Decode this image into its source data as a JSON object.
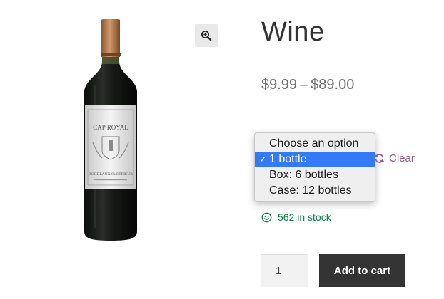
{
  "product": {
    "title": "Wine",
    "price_min": "$9.99",
    "price_separator": "–",
    "price_max": "$89.00",
    "image_alt": "Wine bottle",
    "bottle_label_brand": "CAP ROYAL",
    "bottle_label_appellation": "BORDEAUX SUPÉRIEUR"
  },
  "gallery": {
    "zoom_icon": "magnifier-plus-icon"
  },
  "variation_select": {
    "options": [
      {
        "label": "Choose an option",
        "selected": false
      },
      {
        "label": "1 bottle",
        "selected": true
      },
      {
        "label": "Box: 6 bottles",
        "selected": false
      },
      {
        "label": "Case: 12 bottles",
        "selected": false
      }
    ],
    "selected_marker": "✓"
  },
  "reset": {
    "label": "Clear",
    "icon": "refresh-icon"
  },
  "stock": {
    "text": "562 in stock",
    "icon": "smiley-icon"
  },
  "cart": {
    "quantity": "1",
    "button_label": "Add to cart"
  },
  "colors": {
    "accent_link": "#96588a",
    "in_stock": "#0f834d",
    "button_bg": "#333333",
    "select_highlight": "#3479f6"
  }
}
